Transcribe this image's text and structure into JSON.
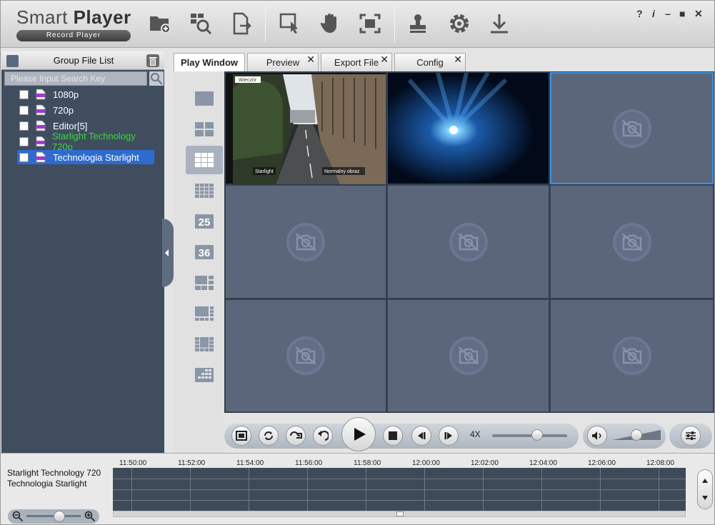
{
  "app": {
    "title_light": "Smart",
    "title_bold": "Player",
    "subtitle": "Record Player"
  },
  "toolbar": {
    "icons": [
      "add-folder-icon",
      "search-file-icon",
      "export-file-icon",
      "select-area-icon",
      "hand-icon",
      "fullscreen-icon",
      "stamp-icon",
      "gear-icon",
      "download-icon"
    ]
  },
  "window_controls": {
    "help": "?",
    "info": "i",
    "minimize": "–",
    "maximize": "■",
    "close": "✕"
  },
  "left_panel": {
    "title": "Group File List",
    "search_placeholder": "Please Input Search Key",
    "files": [
      {
        "name": "1080p",
        "color": "#ffffff"
      },
      {
        "name": "720p",
        "color": "#ffffff"
      },
      {
        "name": "Editor[5]",
        "color": "#ffffff"
      },
      {
        "name": "Starlight Technology 720p",
        "color": "#3dd63d"
      },
      {
        "name": "Technologia Starlight",
        "color": "#ffffff"
      }
    ]
  },
  "tabs": [
    {
      "label": "Play Window",
      "active": true
    },
    {
      "label": "Preview",
      "close": "✕"
    },
    {
      "label": "Export File",
      "close": "✕"
    },
    {
      "label": "Config",
      "close": "✕"
    }
  ],
  "layouts": {
    "split25": "25",
    "split36": "36"
  },
  "video": {
    "overlay_top": "Wieczór",
    "overlay_left": "Starlight",
    "overlay_right": "Normalny obraz"
  },
  "controls": {
    "speed": "4X",
    "speed_level": 0.6,
    "volume_level": 0.5
  },
  "timeline": {
    "tracks": [
      "Starlight Technology 720",
      "Technologia Starlight"
    ],
    "times": [
      "11:50:00",
      "11:52:00",
      "11:54:00",
      "11:56:00",
      "11:58:00",
      "12:00:00",
      "12:02:00",
      "12:04:00",
      "12:06:00",
      "12:08:00"
    ],
    "zoom_level": 0.6
  },
  "colors": {
    "accent": "#2e6bcf",
    "panel": "#3f4d5f",
    "cell": "#5b667b",
    "selected_border": "#3a93e6"
  }
}
